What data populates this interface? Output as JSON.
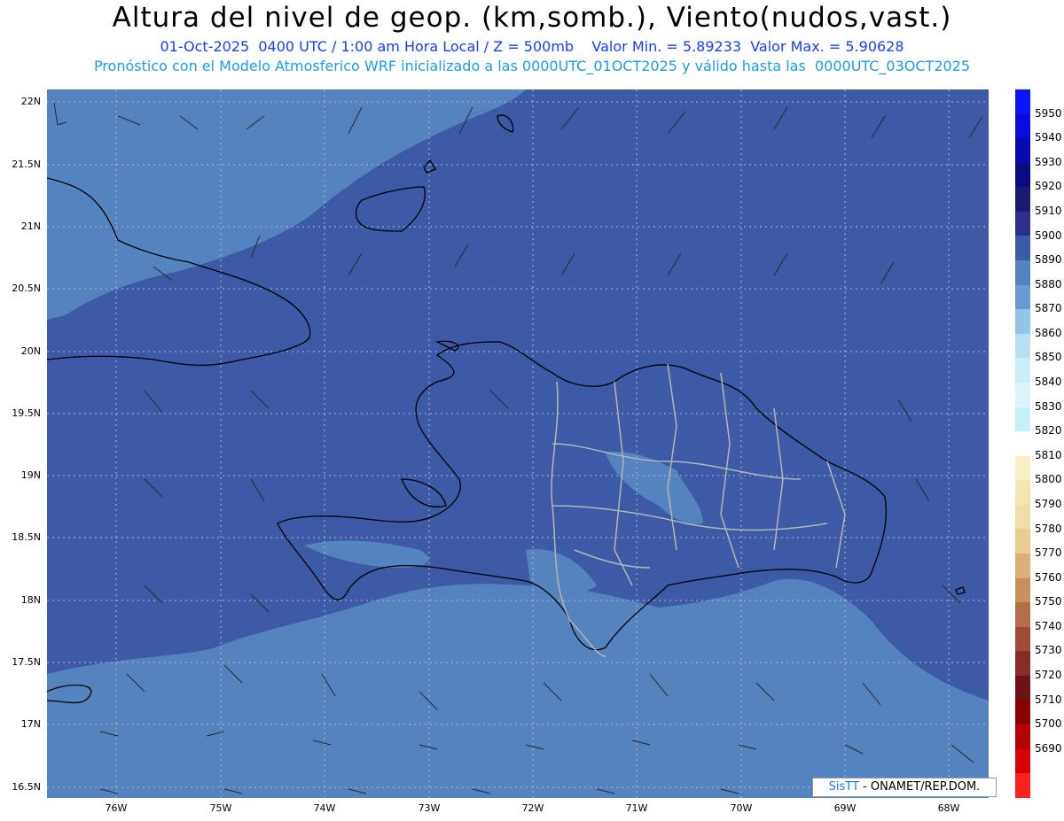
{
  "header": {
    "title": "Altura del nivel de geop. (km,somb.), Viento(nudos,vast.)",
    "line1": "01-Oct-2025  0400 UTC / 1:00 am Hora Local / Z = 500mb    Valor Min. = 5.89233  Valor Max. = 5.90628",
    "line2": "Pronóstico con el Modelo Atmosferico WRF inicializado a las 0000UTC_01OCT2025 y válido hasta las  0000UTC_03OCT2025"
  },
  "map": {
    "lat_labels": [
      "22N",
      "21.5N",
      "21N",
      "20.5N",
      "20N",
      "19.5N",
      "19N",
      "18.5N",
      "18N",
      "17.5N",
      "17N",
      "16.5N"
    ],
    "lon_labels": [
      "76W",
      "75W",
      "74W",
      "73W",
      "72W",
      "71W",
      "70W",
      "69W",
      "68W"
    ],
    "colors": {
      "background": "#3c5aa6",
      "lighter": "#5484c0",
      "light_patch": "#6a9ad0"
    }
  },
  "colorbar": {
    "labels": [
      "5950",
      "5940",
      "5930",
      "5920",
      "5910",
      "5900",
      "5890",
      "5880",
      "5870",
      "5860",
      "5850",
      "5840",
      "5830",
      "5820",
      "5810",
      "5800",
      "5790",
      "5780",
      "5770",
      "5760",
      "5750",
      "5740",
      "5730",
      "5720",
      "5710",
      "5700",
      "5690"
    ],
    "colors": [
      "#0a14ff",
      "#0a0ae0",
      "#0a0ab4",
      "#0c0a80",
      "#1a1a6e",
      "#2e2e8e",
      "#3c5aa6",
      "#5484c0",
      "#6a9ad0",
      "#94c4e6",
      "#b8def0",
      "#cceef6",
      "#ddf4fa",
      "#c8f0f8",
      "#ffffff",
      "#f8f0c8",
      "#f2e6b4",
      "#efdcaa",
      "#e9cc94",
      "#dcb07c",
      "#c8905e",
      "#b4704c",
      "#a04a38",
      "#8a2a2a",
      "#6e1018",
      "#8a0000",
      "#b40000",
      "#d80000",
      "#ff2020"
    ]
  },
  "credit": {
    "sis": "SisTT",
    "rest": " - ONAMET/REP.DOM."
  }
}
